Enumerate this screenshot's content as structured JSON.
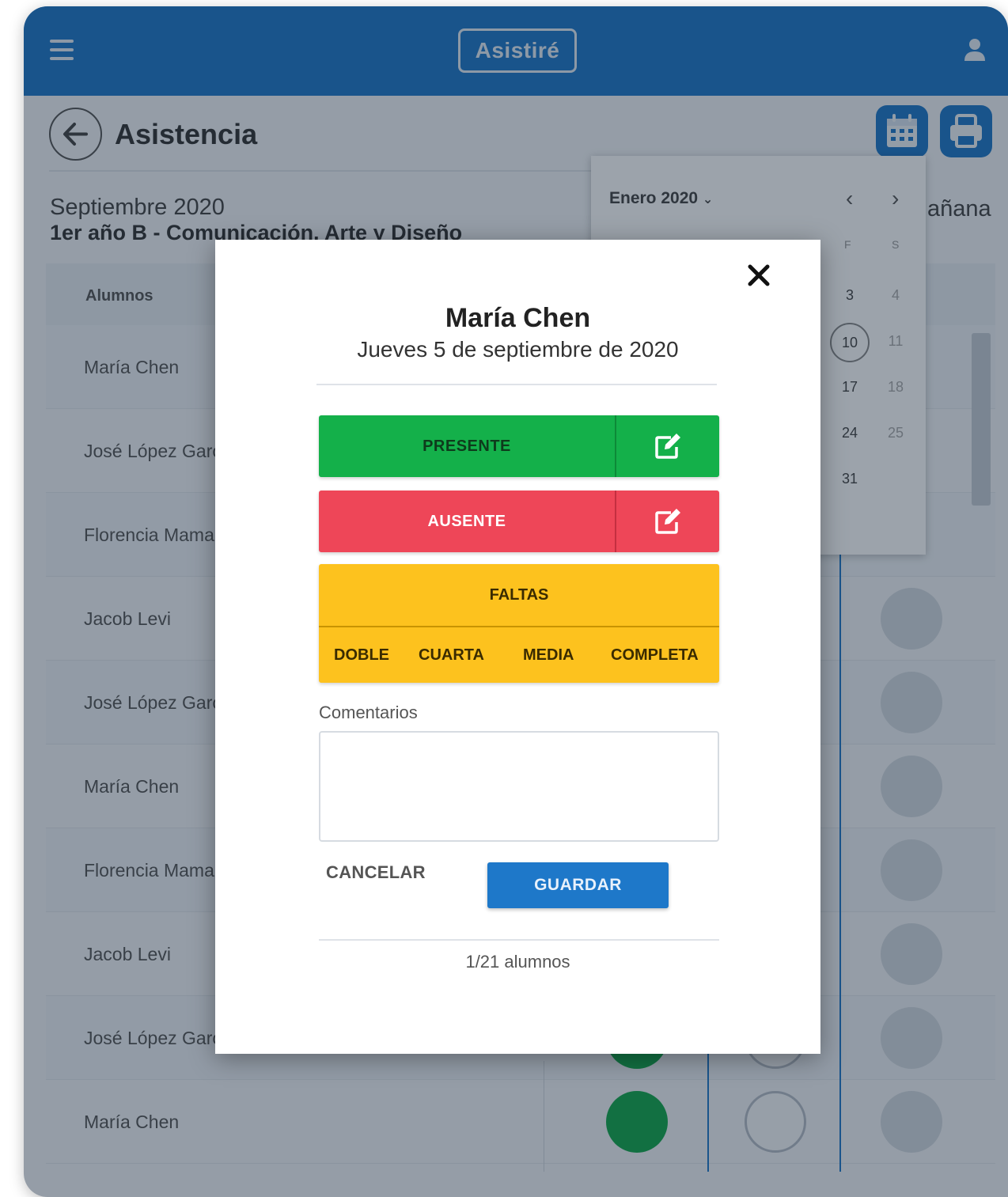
{
  "appbar": {
    "brand": "Asistiré"
  },
  "page": {
    "title": "Asistencia",
    "month": "Septiembre 2020",
    "course": "1er año B - Comunicación, Arte y Diseño",
    "manana_fragment": "añana",
    "table_header": "Alumnos",
    "rows": [
      "María Chen",
      "José López García",
      "Florencia Mamani",
      "Jacob Levi",
      "José López García",
      "María Chen",
      "Florencia Mamani",
      "Jacob Levi",
      "José López García",
      "María Chen"
    ]
  },
  "calendar": {
    "month_label": "Enero 2020",
    "weekdays": [
      "F",
      "S"
    ],
    "days": [
      {
        "d": "3",
        "col": 0,
        "row": 0
      },
      {
        "d": "4",
        "col": 1,
        "row": 0
      },
      {
        "d": "10",
        "col": 0,
        "row": 1
      },
      {
        "d": "11",
        "col": 1,
        "row": 1
      },
      {
        "d": "17",
        "col": 0,
        "row": 2
      },
      {
        "d": "18",
        "col": 1,
        "row": 2
      },
      {
        "d": "24",
        "col": 0,
        "row": 3
      },
      {
        "d": "25",
        "col": 1,
        "row": 3
      },
      {
        "d": "31",
        "col": 0,
        "row": 4
      }
    ],
    "selected_day": "10"
  },
  "modal": {
    "student": "María Chen",
    "date": "Jueves 5 de septiembre de 2020",
    "presente": "PRESENTE",
    "ausente": "AUSENTE",
    "faltas": "FALTAS",
    "faltas_options": [
      "DOBLE",
      "CUARTA",
      "MEDIA",
      "COMPLETA"
    ],
    "comments_label": "Comentarios",
    "comments_value": "",
    "cancel": "CANCELAR",
    "save": "GUARDAR",
    "counter": "1/21 alumnos"
  },
  "colors": {
    "primary": "#1e78c9",
    "presente": "#14b04a",
    "ausente": "#ee4658",
    "faltas": "#fdc21e"
  }
}
